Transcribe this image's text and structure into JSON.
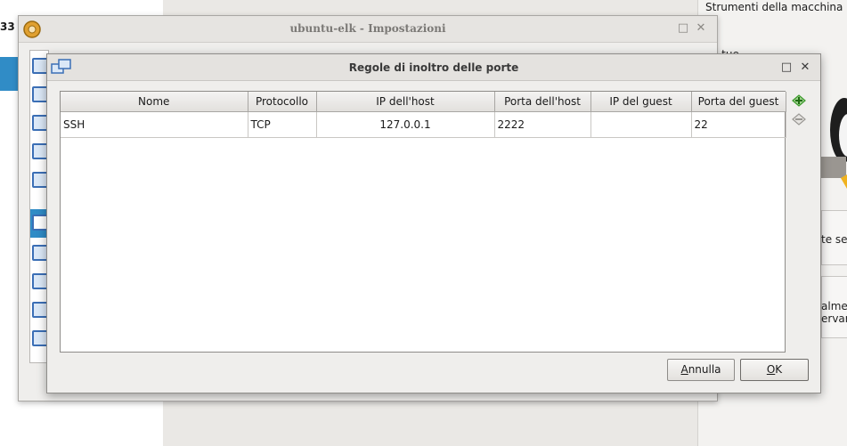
{
  "background": {
    "left_number": "33",
    "machine_tools_label": "Strumenti della macchina",
    "fragments": {
      "tue": "l tue",
      "te_se": "te se",
      "almer": "almer",
      "ervar": "ervar"
    }
  },
  "settings_window": {
    "title": "ubuntu-elk - Impostazioni",
    "minimize": "□",
    "close": "✕"
  },
  "dialog": {
    "title": "Regole di inoltro delle porte",
    "minimize": "□",
    "close": "✕",
    "columns": [
      "Nome",
      "Protocollo",
      "IP dell'host",
      "Porta dell'host",
      "IP del guest",
      "Porta del guest"
    ],
    "rows": [
      {
        "name": "SSH",
        "protocol": "TCP",
        "host_ip": "127.0.0.1",
        "host_port": "2222",
        "guest_ip": "",
        "guest_port": "22"
      }
    ],
    "tools": {
      "add_icon": "add-rule-icon",
      "remove_icon": "remove-rule-icon"
    },
    "buttons": {
      "cancel_mnemonic": "A",
      "cancel_rest": "nnulla",
      "ok_mnemonic": "O",
      "ok_rest": "K"
    }
  },
  "colors": {
    "selection": "#308cc6",
    "add_green": "#3a9a2a"
  }
}
